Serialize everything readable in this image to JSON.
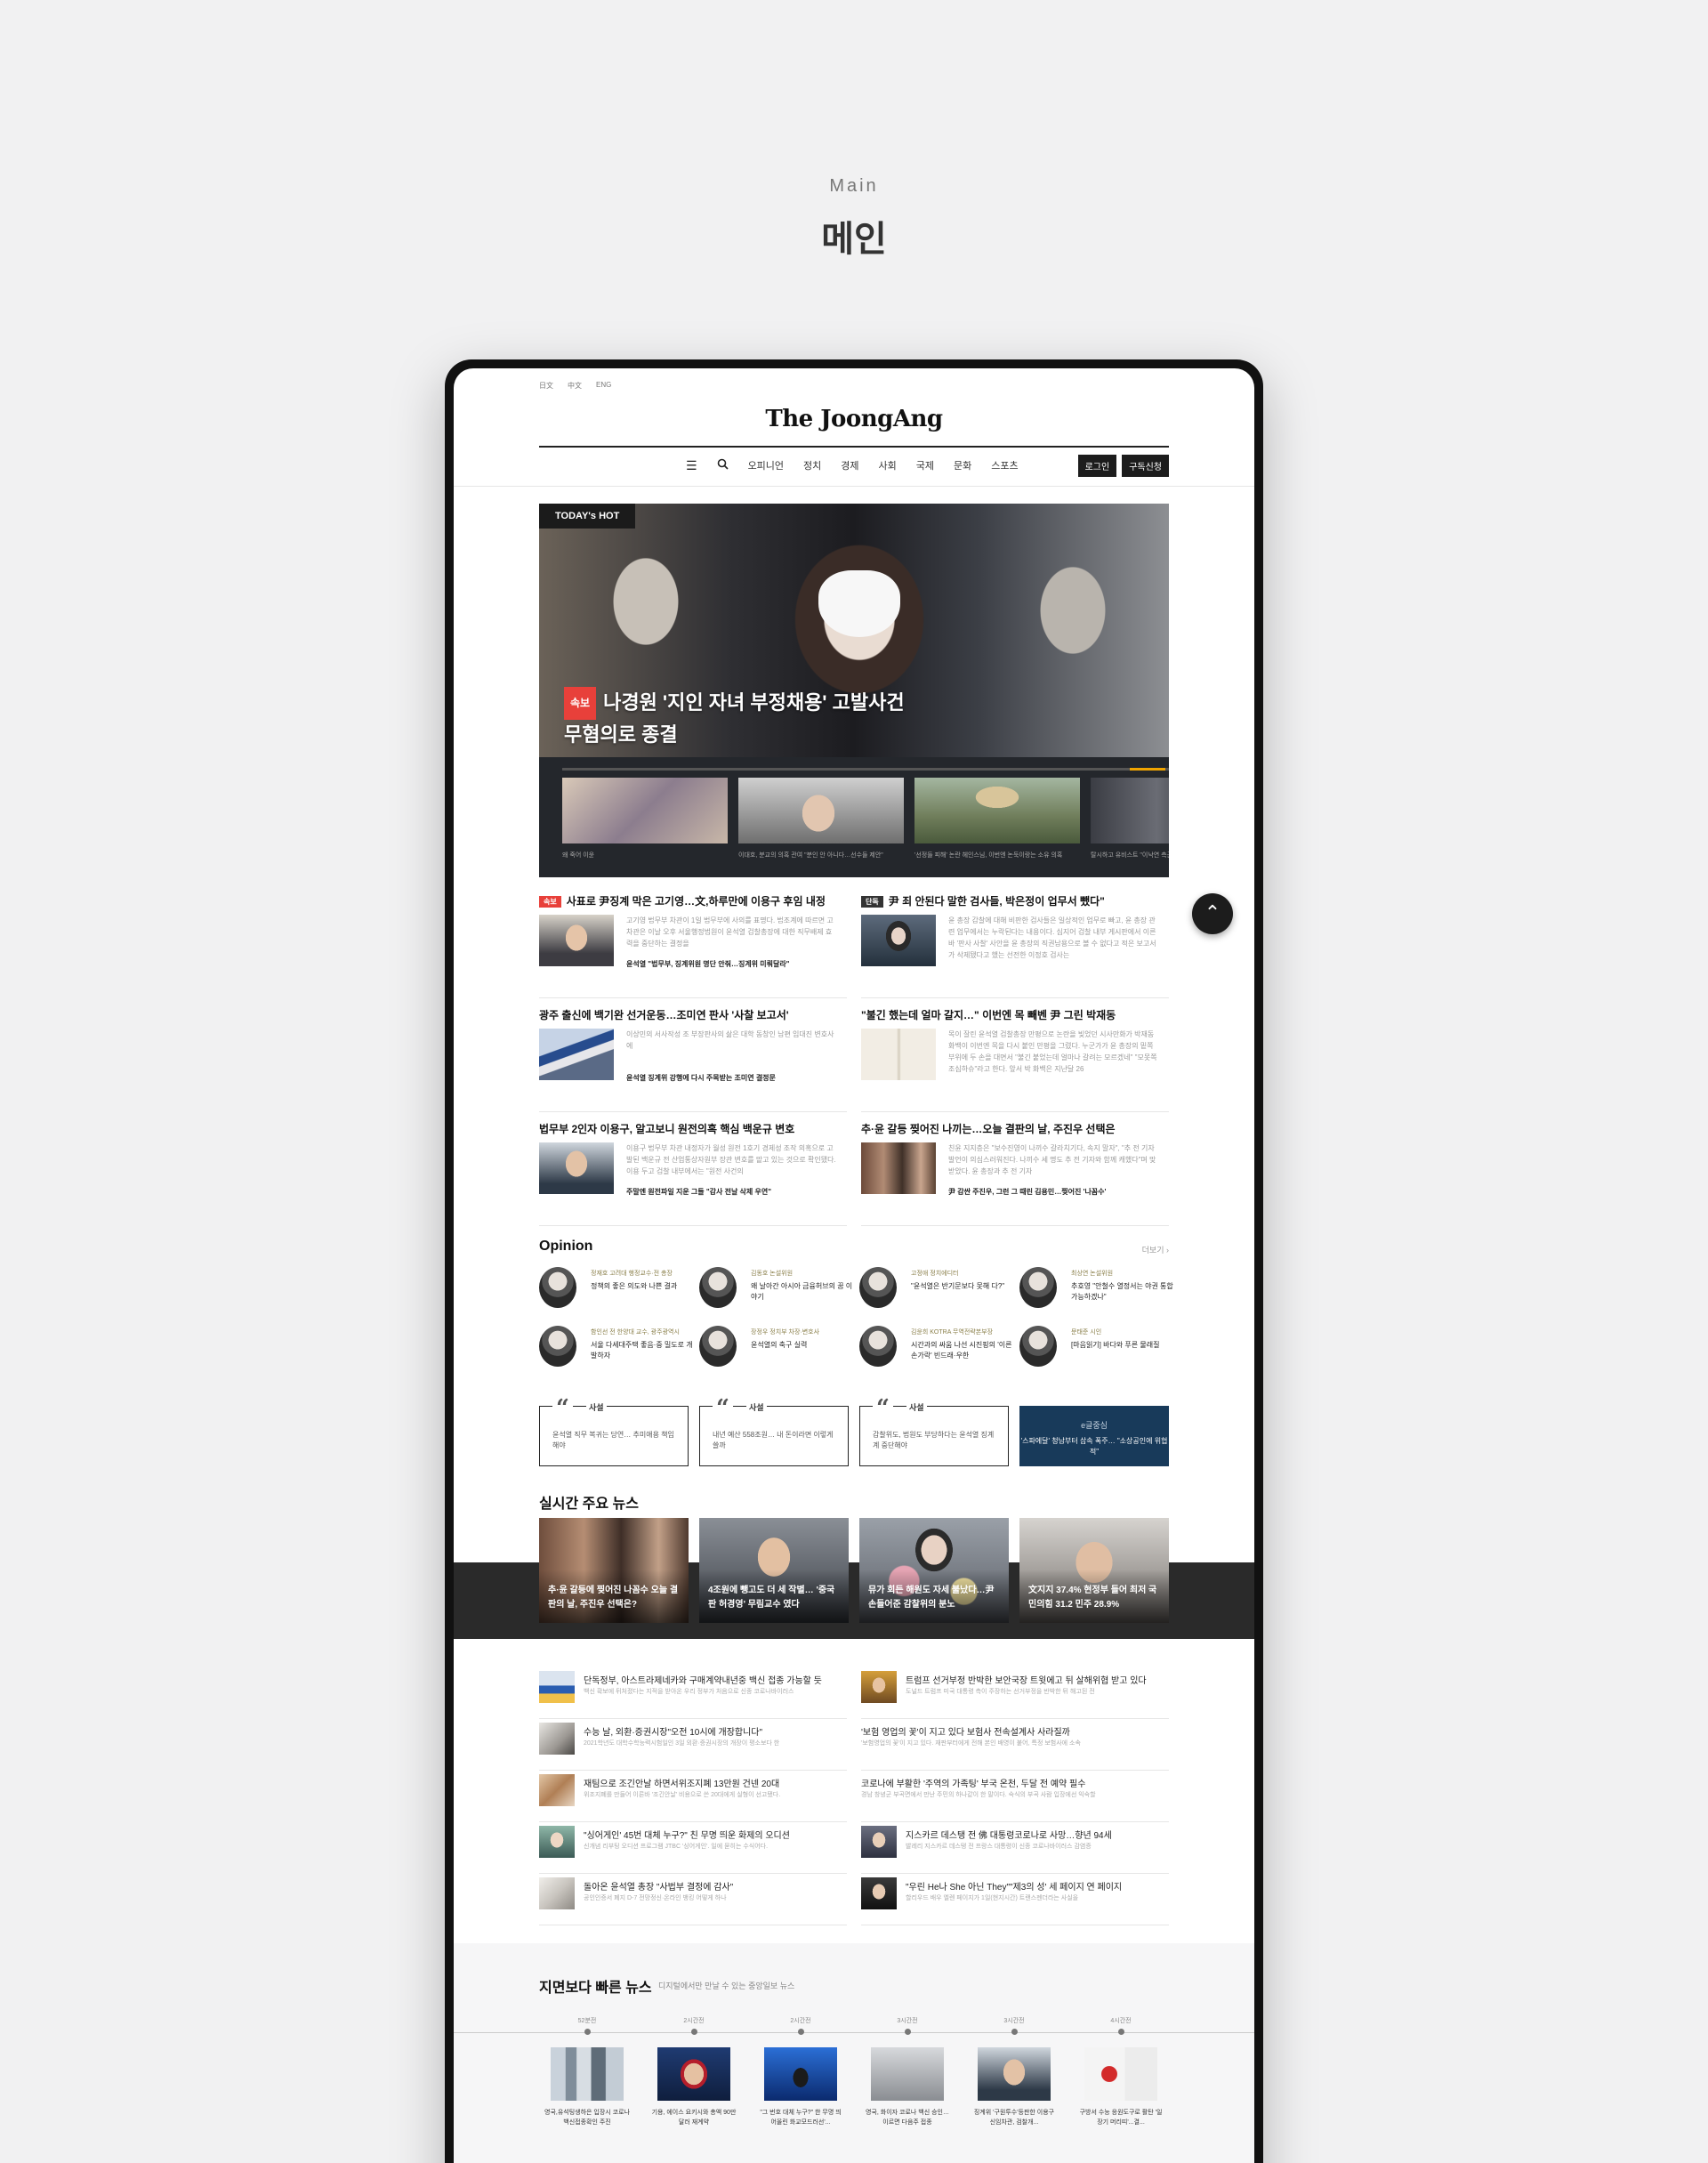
{
  "section": {
    "en": "Main",
    "ko": "메인"
  },
  "header": {
    "langs": [
      "日文",
      "中文",
      "ENG"
    ],
    "logo": "The JoongAng",
    "menu": [
      "오피니언",
      "정치",
      "경제",
      "사회",
      "국제",
      "문화",
      "스포츠"
    ],
    "login": "로그인",
    "subscribe": "구독신청"
  },
  "hero": {
    "badge": "TODAY's HOT",
    "flag": "속보",
    "title_line1": "나경원 '지인 자녀 부정채용' 고발사건",
    "title_line2": "무혐의로 종결",
    "thumbs": [
      {
        "caption": "왜 죽어 이윤"
      },
      {
        "caption": "이대호, 분교의 의혹 관여 \"분인 안 아니다…선수들 제안\""
      },
      {
        "caption": "'선정들 피해' 논란 헤인스님, 이번엔 논둑이랑는 소유 의혹"
      },
      {
        "caption": "탈시하고 유비스트 \"이낙연 측근, 기업서 돈 받았다\""
      }
    ]
  },
  "news": [
    {
      "flag": "속보",
      "title": "사표로 尹징계 막은 고기영…文,하루만에 이용구 후임 내정",
      "desc": "고기영 법무부 차관이 1일 법무부에 사의를 표명다. 법조계에 따르면 고 차관은 이날 오후 서울행정법원이 윤석열 검찰총장에 대한 직무배제 효력을 중단하는 결정을",
      "rel": "윤석열 \"법무부, 징계위원 명단 안줘…징계위 미뤄달라\""
    },
    {
      "flag": "단독",
      "title": "尹 죄 안된다 말한 검사들, 박은정이 업무서 뺐다\"",
      "desc": "윤 총장 감찰에 대해 비판한 검사들은 일상적인 업무로 빠고, 윤 총장 관련 업무에서는 누락된다는 내용이다. 심지어 검찰 내부 게시판에서 이른바 '판사 사찰' 사안을 윤 총장의 직권남용으로 볼 수 없다고 적은 보고서가 삭제됐다고 했는 선전한 이정호 검사는",
      "rel": ""
    },
    {
      "flag": "",
      "title": "광주 출신에 백기완 선거운동…조미연 판사 '사찰 보고서'",
      "desc": "이상민의 서사작성 조 부장판사의 삶은 대학 동창인 남편 임대진 변호사에",
      "rel": "윤석열 징계위 강행에 다시 주목받는 조미연 결정문"
    },
    {
      "flag": "",
      "title": "\"불긴 했는데 얼마 갈지…\" 이번엔 목 빼벤 尹 그린 박재동",
      "desc": "목이 잘린 윤석열 검찰총장 만평으로 논란을 빚었던 시사만화가 박재동 화백이 이번엔 목을 다시 붙인 만평을 그렸다. 누군가가 윤 총장의 밑쪽 부위에 두 손을 대면서 \"불긴 붙었는데 얼마나 갈려는 모르겠네\" \"모못쪽 조심하슈\"라고 한다. 앞서 박 화백은 지난달 26",
      "rel": ""
    },
    {
      "flag": "",
      "title": "법무부 2인자 이용구, 알고보니 원전의혹 핵심 백운규 변호",
      "desc": "이용구 법무부 차관 내정자가 월성 원전 1호기 경제성 조작 의혹으로 고발된 백운규 전 산업통상자원부 장관 변호를 맡고 있는 것으로 확인됐다. 이용 두고 검찰 내부에서는 \"원전 사건의",
      "rel": "주말엔 원전파일 지운 그들 \"감사 전날 삭제 우연\""
    },
    {
      "flag": "",
      "title": "추·윤 갈등 찢어진 나끼는…오늘 결판의 날, 주진우 선택은",
      "desc": "친윤 지지층은 \"보수진영이 나끼수 갈라치기다, 속지 말자\", \"추 전 기자 발언이 의심스러워진다. 나끼수 세 명도 추 전 기자와 함께 캐했다\"며 맞받았다. 윤 총장과 추 전 기자",
      "rel": "尹 감싼 주진우, 그런 그 때린 김용민…찢어진 '나꼼수'"
    }
  ],
  "opinion": {
    "title": "Opinion",
    "more": "더보기 ›",
    "items": [
      {
        "name": "정재호 고려대 행정교수·전 총장",
        "text": "정책의 좋은 의도와 나쁜 결과"
      },
      {
        "name": "김동호 논설위원",
        "text": "왜 날아간 아시아 금융허브의 꿈 이야기"
      },
      {
        "name": "고정애 정치에디터",
        "text": "\"윤석열은 반기문보다 못해 다?\""
      },
      {
        "name": "최상연 논설위원",
        "text": "추호영 \"안철수 열정서는 야권 통합 가능하겠나\""
      },
      {
        "name": "함인선 전 한양대 교수, 광주광역시",
        "text": "서울 다세대주택 좋음·중 밀도로 개발하자"
      },
      {
        "name": "장정우 정치부 차장·변호사",
        "text": "윤석열의 축구 실력"
      },
      {
        "name": "김윤희 KOTRA 무역전략본부장",
        "text": "시간과의 싸움 나선 시진핑의 '이른 손가락' 빈드래·우한"
      },
      {
        "name": "문태준 시인",
        "text": "[마음읽기] 바다와 푸른 물래질"
      }
    ]
  },
  "cards": [
    {
      "label": "사설",
      "text": "윤석열 직무 복귀는 당연… 추미애용 책임해야"
    },
    {
      "label": "사설",
      "text": "내년 예산 558조원… 내 돈이라면 이렇게 쓸까"
    },
    {
      "label": "사설",
      "text": "감찰위도, 법원도 부당하다는 윤석열 징계계 중단해야"
    },
    {
      "label": "e글중심",
      "text": "'스파에달' 청남부터 삽속 폭주… \"소상공인에 위협적\""
    }
  ],
  "realtime": {
    "title": "실시간 주요 뉴스",
    "items": [
      {
        "caption": "추·윤 갈등에 찢어진 나꼼수 오늘 결판의 날, 주진우 선택은?"
      },
      {
        "caption": "4조원에 뺑고도 더 세 작별… '중국판 허경영' 무림교수 였다"
      },
      {
        "caption": "뮤가 회든 해원도 자세 불났다…尹 손들어준 감찰위의 분노"
      },
      {
        "caption": "文지지 37.4% 현정부 들어 최저 국민의힘 31.2 민주 28.9%"
      }
    ]
  },
  "list": [
    {
      "title": "단독정부, 아스트라제네카와 구매계약내년중 백신 접종 가능할 듯",
      "desc": "백신 확보에 뒤처졌다는 지적을 받아온 우리 정부가 처음으로 신종 코로나바이러스"
    },
    {
      "title": "트럼프 선거부정 반박한 보안국장 트윗에고 뒤 살해위협 받고 있다",
      "desc": "도널드 트럼프 미국 대통령 측이 주장하는 선거부정을 반박한 뒤 해고된 전"
    },
    {
      "title": "수능 날, 외환·증권시장\"오전 10시에 개장합니다\"",
      "desc": "2021학년도 대학수학능력시험일인 3일 외환·증권시장의 개장이 평소보다 한"
    },
    {
      "title": "'보험 영업의 꽃'이 지고 있다 보험사 전속설계사 사라질까",
      "desc": "'보험영업의 꽃'이 지고 있다. 재판부터에게 전해 본인 배영이 붙어, 특정 보험사에 소속"
    },
    {
      "title": "재팀으로 조긴안날 하면서위조지폐 13만원 건넨 20대",
      "desc": "위조지폐를 만들어 이른바 '조긴안날' 비용으로 쓴 20대에게 실형이 선고됐다."
    },
    {
      "title": "코로나에 부활한 '주역의 가족팅' 부국 온천, 두달 전 예약 필수",
      "desc": "경남 창녕군 부곡면에서 만난 주민의 하나같이 한 말이다. 숙식의 부곡 사람 입장에선 익숙할"
    },
    {
      "title": "\"싱어게인' 45번 대체 누구?\" 친 무명 띄운 화제의 오디션",
      "desc": "신개념 리부팅 오디션 프로그램 JTBC '싱어게인'. 일에 묻히는 수식어다."
    },
    {
      "title": "지스카르 데스탱 전 佛 대통령코로나로 사망…향년 94세",
      "desc": "발레리 지스카르 데스탱 전 프랑스 대통령이 신종 코로나바이러스 감염증"
    },
    {
      "title": "돌아온 윤석열 총장 \"사법부 결정에 감사\"",
      "desc": "공인인증서 폐지 D-7 전망정신·온라인 뱅킹 어떻게 하나"
    },
    {
      "title": "\"우린 He나 She 아닌 They\"\"제3의 성' 세 페이지 연 페이지",
      "desc": "할리우드 배우 엘렌 페이지가 1일(현지시간) 트랜스젠더라는 사실을"
    }
  ],
  "faster": {
    "title": "지면보다 빠른 뉴스",
    "subtitle": "디지털에서만 만날 수 있는 중앙일보 뉴스",
    "items": [
      {
        "time": "52분전",
        "caption": "영국,유석팅생하은 입장시 코로나 백신접종확인 주진"
      },
      {
        "time": "2시간전",
        "caption": "기용, 에이스 요키시와 총액 90만 달러 재계약"
      },
      {
        "time": "2시간전",
        "caption": "\"그 번호 대체 누구?\" 한 무명 띄어올린 화교모드러선'..."
      },
      {
        "time": "3시간전",
        "caption": "영국, 화이자 코로나 백신 승인…이르면 다음주 접종"
      },
      {
        "time": "3시간전",
        "caption": "징계위 '구원투수'등판한 이용구 신임차관, 검찰개..."
      },
      {
        "time": "4시간전",
        "caption": "구방서 수능 응원도구로 활탄 '일장기 머리띠'...결..."
      }
    ]
  },
  "colors": {
    "accent_red": "#e8403a",
    "dark": "#1c1c1c",
    "editorial_blue": "#183a5a"
  }
}
